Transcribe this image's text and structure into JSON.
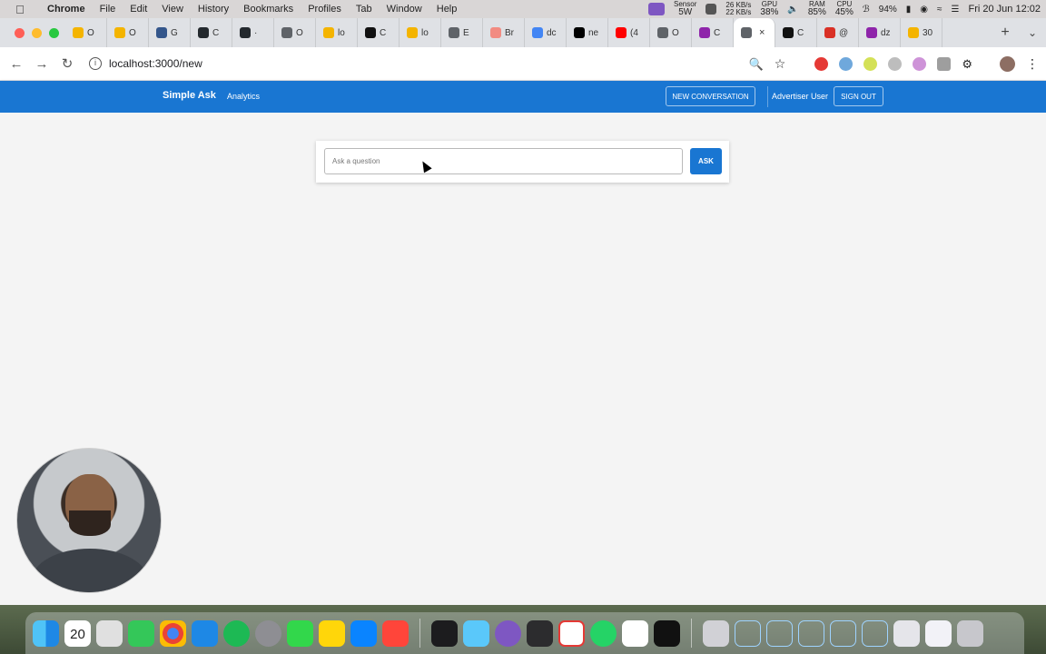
{
  "menubar": {
    "app_name": "Chrome",
    "menus": [
      "File",
      "Edit",
      "View",
      "History",
      "Bookmarks",
      "Profiles",
      "Tab",
      "Window",
      "Help"
    ],
    "sensor_label": "Sensor",
    "sensor_value": "5W",
    "net_up": "26 KB/s",
    "net_down": "22 KB/s",
    "gpu_label": "GPU",
    "gpu_value": "38%",
    "ram_label": "RAM",
    "ram_value": "85%",
    "cpu_label": "CPU",
    "cpu_value": "45%",
    "battery": "94%",
    "datetime": "Fri 20 Jun  12:02"
  },
  "tabs": [
    {
      "label": "O",
      "color": "#f4b400"
    },
    {
      "label": "O",
      "color": "#f4b400"
    },
    {
      "label": "G",
      "color": "#34568b"
    },
    {
      "label": "C",
      "color": "#24292e"
    },
    {
      "label": "·",
      "color": "#24292e"
    },
    {
      "label": "O",
      "color": "#5f6368"
    },
    {
      "label": "lo",
      "color": "#f4b400"
    },
    {
      "label": "C",
      "color": "#111111"
    },
    {
      "label": "lo",
      "color": "#f4b400"
    },
    {
      "label": "E",
      "color": "#5f6368"
    },
    {
      "label": "Br",
      "color": "#f28b82"
    },
    {
      "label": "dc",
      "color": "#4285f4"
    },
    {
      "label": "ne",
      "color": "#000000"
    },
    {
      "label": "(4",
      "color": "#ff0000"
    },
    {
      "label": "O",
      "color": "#5f6368"
    },
    {
      "label": "C",
      "color": "#8e24aa"
    },
    {
      "label": "",
      "color": "#5f6368",
      "active": true
    },
    {
      "label": "C",
      "color": "#111111"
    },
    {
      "label": "@",
      "color": "#d93025"
    },
    {
      "label": "dz",
      "color": "#8e24aa"
    },
    {
      "label": "30",
      "color": "#f4b400"
    }
  ],
  "toolbar": {
    "url": "localhost:3000/new"
  },
  "app": {
    "brand": "Simple Ask",
    "nav_analytics": "Analytics",
    "new_conversation": "NEW CONVERSATION",
    "user_name": "Advertiser User",
    "sign_out": "SIGN OUT"
  },
  "ask": {
    "placeholder": "Ask a question",
    "button_label": "ASK"
  },
  "dock": {
    "calendar_day": "20"
  }
}
